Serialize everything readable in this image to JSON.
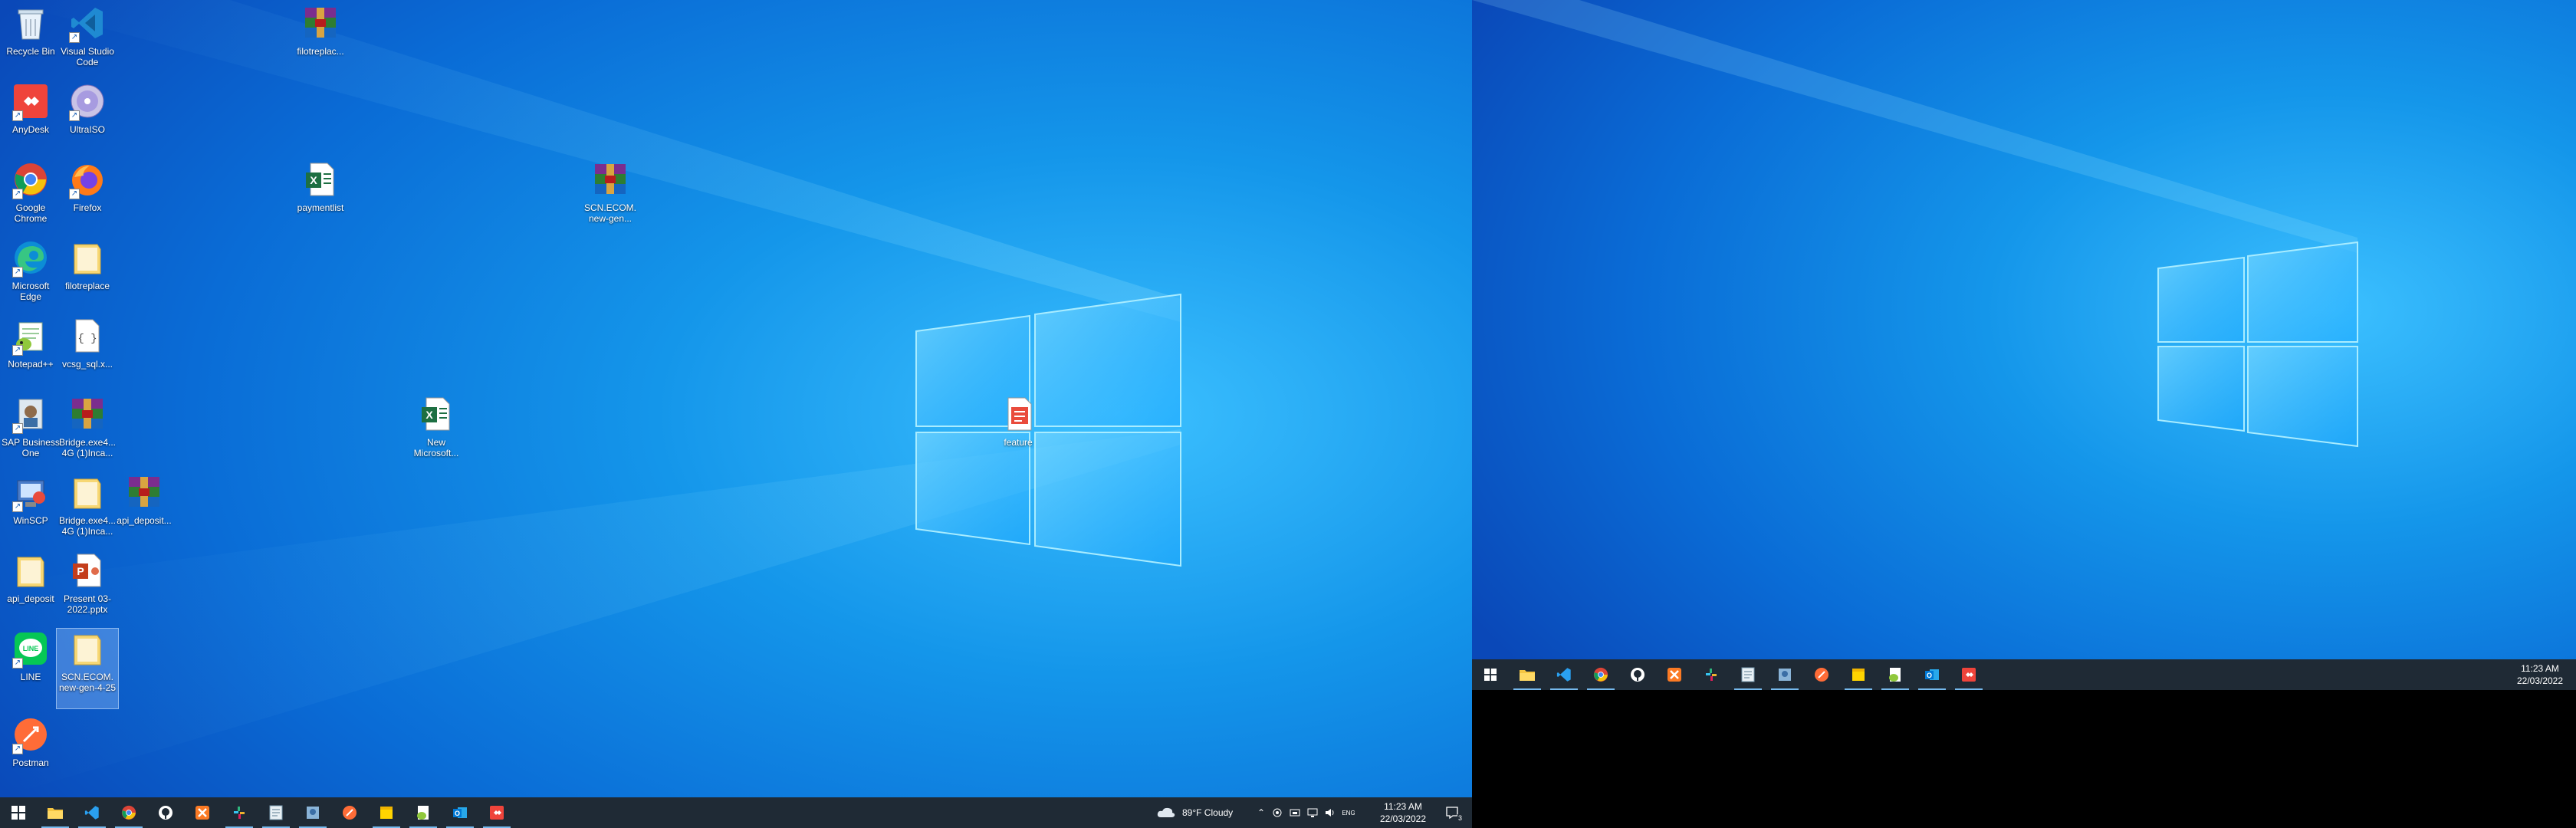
{
  "desktop": {
    "icons": [
      {
        "label": "Recycle Bin"
      },
      {
        "label": "Visual Studio Code"
      },
      {
        "label": "filotreplac..."
      },
      {
        "label": "AnyDesk"
      },
      {
        "label": "UltraISO"
      },
      {
        "label": "Google Chrome"
      },
      {
        "label": "Firefox"
      },
      {
        "label": "paymentlist"
      },
      {
        "label": "SCN.ECOM. new-gen..."
      },
      {
        "label": "Microsoft Edge"
      },
      {
        "label": "filotreplace"
      },
      {
        "label": "Notepad++"
      },
      {
        "label": "vcsg_sql.x..."
      },
      {
        "label": "SAP Business One"
      },
      {
        "label": "Bridge.exe4... 4G (1)Inca..."
      },
      {
        "label": "New Microsoft..."
      },
      {
        "label": "feature"
      },
      {
        "label": "WinSCP"
      },
      {
        "label": "Bridge.exe4... 4G (1)Inca..."
      },
      {
        "label": "api_deposit..."
      },
      {
        "label": "api_deposit"
      },
      {
        "label": "Present 03-2022.pptx"
      },
      {
        "label": "LINE"
      },
      {
        "label": "SCN.ECOM. new-gen-4-25"
      },
      {
        "label": "Postman"
      }
    ]
  },
  "taskbar_left": {
    "apps": [
      "start-icon",
      "file-explorer-icon",
      "vscode-icon",
      "chrome-icon",
      "sourcetree-icon",
      "xampp-icon",
      "slack-icon",
      "notepad-icon",
      "sap-icon",
      "postman-icon",
      "sticky-notes-icon",
      "notepadpp-icon",
      "outlook-icon",
      "anydesk-icon"
    ],
    "weather": "89°F Cloudy",
    "time": "11:23 AM",
    "date": "22/03/2022",
    "notification_count": "3"
  },
  "taskbar_right": {
    "time": "11:23 AM",
    "date": "22/03/2022"
  },
  "colors": {
    "wallpaper_light": "#1ea0f0",
    "wallpaper_dark": "#0a55c8",
    "taskbar": "#1f2a35",
    "accent": "#76b9ed"
  }
}
